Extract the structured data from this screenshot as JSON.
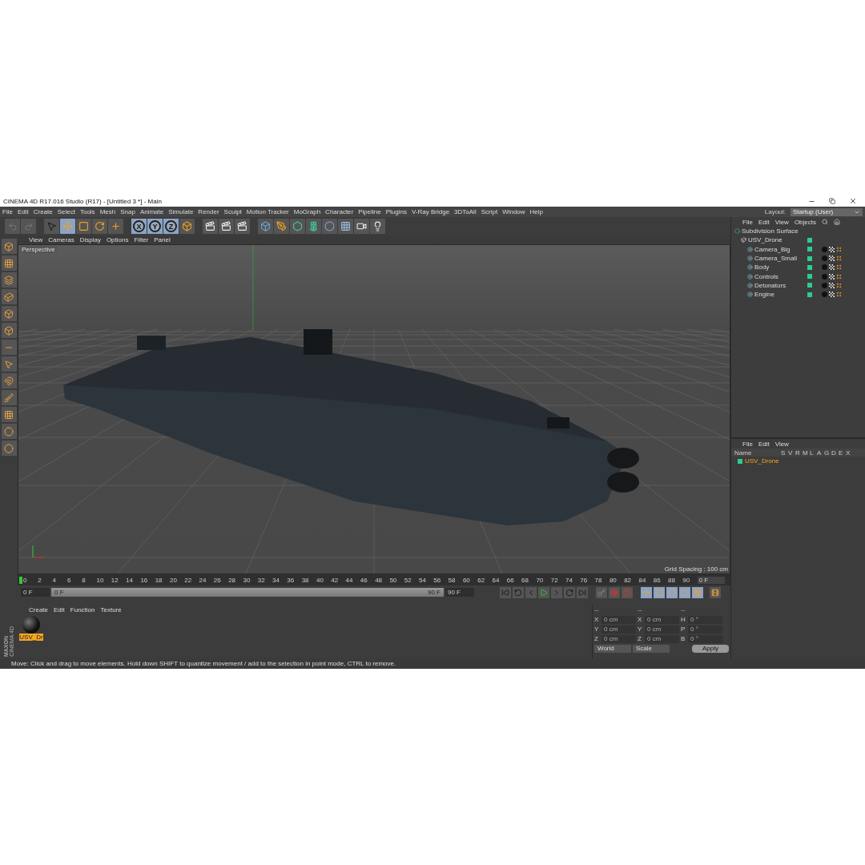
{
  "window": {
    "title": "CINEMA 4D R17.016 Studio (R17) - [Untitled 3 *] - Main"
  },
  "menu": [
    "File",
    "Edit",
    "Create",
    "Select",
    "Tools",
    "Mesh",
    "Snap",
    "Animate",
    "Simulate",
    "Render",
    "Sculpt",
    "Motion Tracker",
    "MoGraph",
    "Character",
    "Pipeline",
    "Plugins",
    "V-Ray Bridge",
    "3DToAll",
    "Script",
    "Window",
    "Help"
  ],
  "layout": {
    "label": "Layout:",
    "value": "Startup (User)"
  },
  "axis_buttons": [
    {
      "label": "X",
      "selected": true
    },
    {
      "label": "Y",
      "selected": true
    },
    {
      "label": "Z",
      "selected": true
    }
  ],
  "tools": [
    {
      "kind": "select",
      "selected": false
    },
    {
      "kind": "move",
      "selected": true
    },
    {
      "kind": "scale",
      "selected": false
    },
    {
      "kind": "rotate",
      "selected": false
    },
    {
      "kind": "last",
      "selected": false
    }
  ],
  "viewport": {
    "menu": [
      "View",
      "Cameras",
      "Display",
      "Options",
      "Filter",
      "Panel"
    ],
    "camera": "Perspective",
    "grid_spacing": "Grid Spacing : 100 cm"
  },
  "timeline": {
    "ticks": [
      "0",
      "2",
      "4",
      "6",
      "8",
      "10",
      "12",
      "14",
      "16",
      "18",
      "20",
      "22",
      "24",
      "26",
      "28",
      "30",
      "32",
      "34",
      "36",
      "38",
      "40",
      "42",
      "44",
      "46",
      "48",
      "50",
      "52",
      "54",
      "56",
      "58",
      "60",
      "62",
      "64",
      "66",
      "68",
      "70",
      "72",
      "74",
      "76",
      "78",
      "80",
      "82",
      "84",
      "86",
      "88",
      "90"
    ],
    "current": "0 F",
    "start": "0 F",
    "range": {
      "start": "0 F",
      "end": "90 F",
      "level": 1
    },
    "end": "90 F"
  },
  "materials": {
    "menu": [
      "Create",
      "Edit",
      "Function",
      "Texture"
    ],
    "items": [
      {
        "name": "USV_Dr",
        "selected": true
      }
    ]
  },
  "brand": {
    "company": "MAXON",
    "product": "CINEMA 4D"
  },
  "coordinates": {
    "headers": [
      "--",
      "--",
      "--"
    ],
    "rows": [
      {
        "a": "X",
        "av": "0 cm",
        "b": "X",
        "bv": "0 cm",
        "c": "H",
        "cv": "0 °"
      },
      {
        "a": "Y",
        "av": "0 cm",
        "b": "Y",
        "bv": "0 cm",
        "c": "P",
        "cv": "0 °"
      },
      {
        "a": "Z",
        "av": "0 cm",
        "b": "Z",
        "bv": "0 cm",
        "c": "B",
        "cv": "0 °"
      }
    ],
    "mode": "World",
    "size_mode": "Scale",
    "apply": "Apply"
  },
  "objects": {
    "menu": [
      "File",
      "Edit",
      "View",
      "Objects"
    ],
    "tree": [
      {
        "name": "Subdivision Surface",
        "kind": "generator",
        "children": [
          {
            "name": "USV_Drone",
            "kind": "null",
            "children": [
              {
                "name": "Camera_Big",
                "kind": "polygon"
              },
              {
                "name": "Camera_Small",
                "kind": "polygon"
              },
              {
                "name": "Body",
                "kind": "polygon"
              },
              {
                "name": "Controls",
                "kind": "polygon"
              },
              {
                "name": "Detonators",
                "kind": "polygon"
              },
              {
                "name": "Engine",
                "kind": "polygon"
              }
            ]
          }
        ]
      }
    ]
  },
  "layers": {
    "menu": [
      "File",
      "Edit",
      "View"
    ],
    "columns": [
      "Name",
      "S",
      "V",
      "R",
      "M",
      "L",
      "A",
      "G",
      "D",
      "E",
      "X"
    ],
    "rows": [
      {
        "name": "USV_Drone",
        "color": "#2ecc8f"
      }
    ]
  },
  "status": "Move: Click and drag to move elements. Hold down SHIFT to quantize movement / add to the selection in point mode, CTRL to remove."
}
